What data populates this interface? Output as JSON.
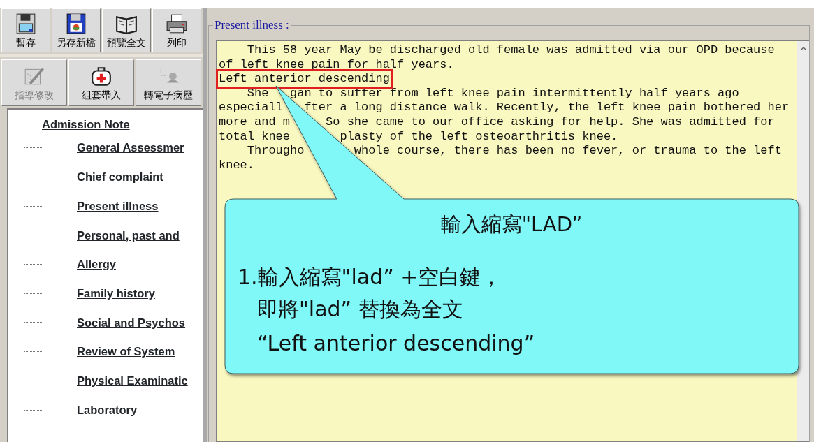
{
  "toolbar_row_1": [
    {
      "label": "暫存",
      "disabled": false
    },
    {
      "label": "另存新檔",
      "disabled": false
    },
    {
      "label": "預覽全文",
      "disabled": false
    },
    {
      "label": "列印",
      "disabled": false
    }
  ],
  "toolbar_row_2": [
    {
      "label": "指導修改",
      "disabled": true
    },
    {
      "label": "組套帶入",
      "disabled": false
    },
    {
      "label": "轉電子病歷",
      "disabled": false
    }
  ],
  "tree": {
    "label": "Admission Note",
    "children": [
      {
        "label": "General Assessmer"
      },
      {
        "label": "Chief complaint"
      },
      {
        "label": "Present illness"
      },
      {
        "label": "Personal, past and"
      },
      {
        "label": "Allergy"
      },
      {
        "label": "Family history"
      },
      {
        "label": "Social and Psychos"
      },
      {
        "label": "Review of System"
      },
      {
        "label": "Physical Examinatic"
      },
      {
        "label": "Laboratory"
      }
    ]
  },
  "editor": {
    "legend": "Present illness :",
    "lines": [
      {
        "text": "    This 58 year May be discharged old female was admitted via our OPD because",
        "highlighted": false
      },
      {
        "text": "of left knee pain for half years.",
        "highlighted": false
      },
      {
        "text": "Left anterior descending",
        "highlighted": true
      },
      {
        "text": "    She   gan to suffer from left knee pain intermittently half years ago",
        "highlighted": false
      },
      {
        "text": "especiall   fter a long distance walk. Recently, the left knee pain bothered her",
        "highlighted": false
      },
      {
        "text": "more and m     So she came to our office asking for help. She was admitted for",
        "highlighted": false
      },
      {
        "text": "total knee       plasty of the left osteoarthritis knee.",
        "highlighted": false
      },
      {
        "text": "    Througho       whole course, there has been no fever, or trauma to the left",
        "highlighted": false
      },
      {
        "text": "knee.",
        "highlighted": false
      }
    ]
  },
  "callout": {
    "title": "輸入縮寫\"LAD”",
    "lines": [
      "1.輸入縮寫\"lad” +空白鍵，",
      "即將\"lad” 替換為全文",
      "“Left anterior descending”"
    ]
  }
}
